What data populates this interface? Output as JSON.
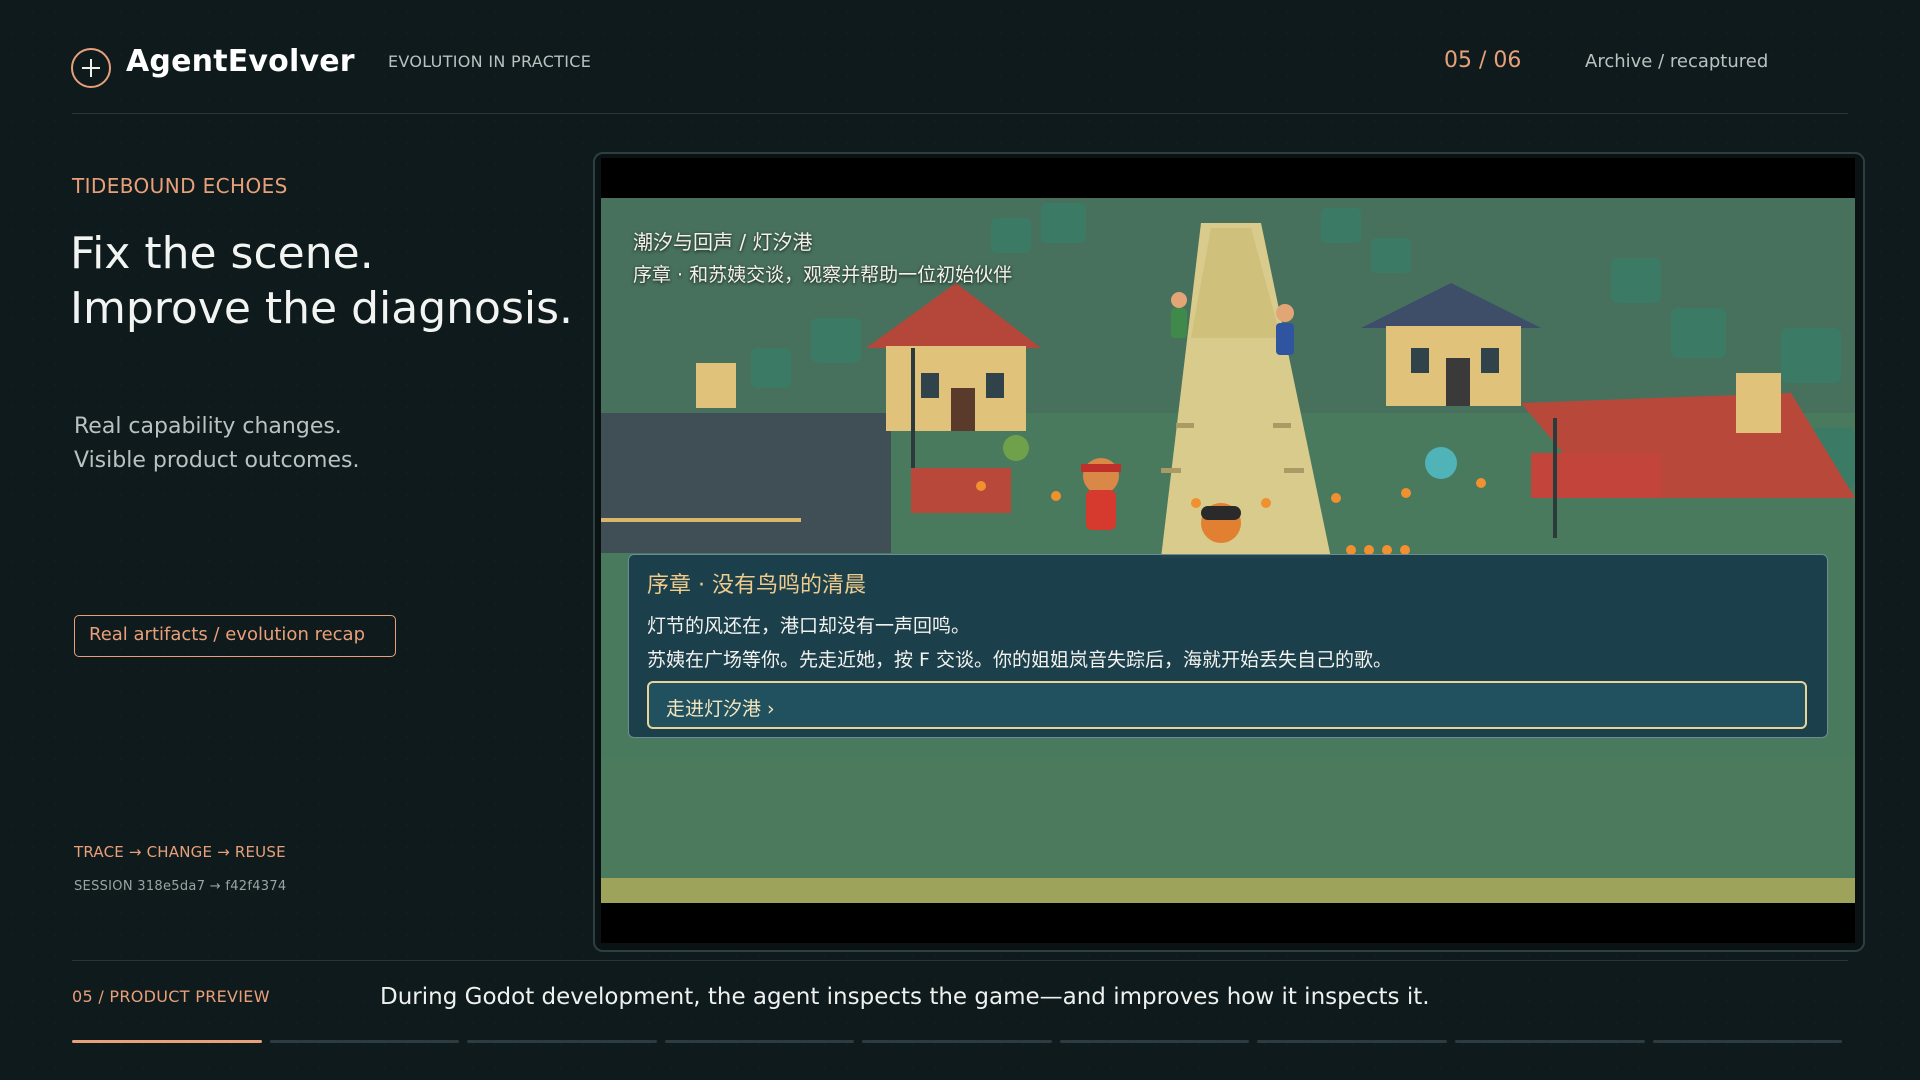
{
  "header": {
    "brand": "AgentEvolver",
    "tagline": "EVOLUTION IN PRACTICE",
    "pager": "05 / 06",
    "archive": "Archive / recaptured"
  },
  "left": {
    "eyebrow": "TIDEBOUND ECHOES",
    "headline_line1": "Fix the scene.",
    "headline_line2": "Improve the diagnosis.",
    "sub_line1": "Real capability changes.",
    "sub_line2": "Visible product outcomes.",
    "pill": "Real artifacts / evolution recap",
    "trace": "TRACE → CHANGE → REUSE",
    "session": "SESSION  318e5da7 → f42f4374"
  },
  "game": {
    "scene_title": "潮汐与回声 / 灯汐港",
    "scene_subtitle": "序章 · 和苏姨交谈，观察并帮助一位初始伙伴",
    "dialog_title": "序章 · 没有鸟鸣的清晨",
    "dialog_line1": "灯节的风还在，港口却没有一声回鸣。",
    "dialog_line2": "苏姨在广场等你。先走近她，按 F 交谈。你的姐姐岚音失踪后，海就开始丢失自己的歌。",
    "dialog_button": "走进灯汐港 ›"
  },
  "footer": {
    "label": "05 / PRODUCT PREVIEW",
    "caption": "During Godot development, the agent inspects the game—and improves how it inspects it.",
    "progress_segments": 9,
    "progress_active": 1
  },
  "colors": {
    "accent": "#e8a07a",
    "background": "#0f1a1c",
    "dialog_bg": "#183c4a",
    "dialog_title": "#efcb8c"
  },
  "icons": {
    "logo": "circle-plus-icon"
  }
}
